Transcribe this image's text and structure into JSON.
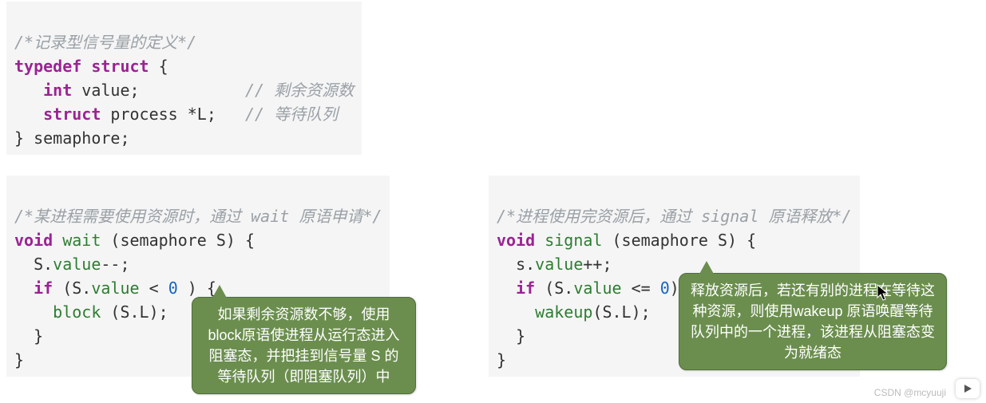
{
  "top": {
    "comment": "/*记录型信号量的定义*/",
    "l1_kw1": "typedef",
    "l1_kw2": "struct",
    "l1_brace": " {",
    "l2_indent": "   ",
    "l2_type": "int",
    "l2_name": " value;",
    "l2_pad": "           ",
    "l2_comment": "// 剩余资源数",
    "l3_indent": "   ",
    "l3_kw": "struct",
    "l3_rest": " process *L;",
    "l3_pad": "   ",
    "l3_comment": "// 等待队列",
    "l4": "} semaphore;"
  },
  "wait": {
    "comment": "/*某进程需要使用资源时，通过 wait 原语申请*/",
    "l1_void": "void",
    "l1_fn": " wait ",
    "l1_sig": "(semaphore S) {",
    "l2_pre": "  S.",
    "l2_mem": "value",
    "l2_post": "--;",
    "l3_pre": "  ",
    "l3_if": "if",
    "l3_mid1": " (S.",
    "l3_mem": "value",
    "l3_mid2": " < ",
    "l3_zero": "0",
    "l3_end": " ) {",
    "l4_pre": "    ",
    "l4_fn": "block",
    "l4_post": " (S.L);",
    "l5": "  }",
    "l6": "}"
  },
  "signal": {
    "comment": "/*进程使用完资源后，通过 signal 原语释放*/",
    "l1_void": "void",
    "l1_fn": " signal ",
    "l1_sig": "(semaphore S) {",
    "l2_pre": "  s.",
    "l2_mem": "value",
    "l2_post": "++;",
    "l3_pre": "  ",
    "l3_if": "if",
    "l3_mid1": " (S.",
    "l3_mem": "value",
    "l3_mid2": " <= ",
    "l3_zero": "0",
    "l3_end": ") {",
    "l4_pre": "    ",
    "l4_fn": "wakeup",
    "l4_post": "(S.L);",
    "l5": "  }",
    "l6": "}"
  },
  "bubbles": {
    "left": "如果剩余资源数不够，使用block原语使进程从运行态进入阻塞态，并把挂到信号量 S 的等待队列（即阻塞队列）中",
    "right": "释放资源后，若还有别的进程在等待这种资源，则使用wakeup 原语唤醒等待队列中的一个进程，该进程从阻塞态变为就绪态"
  },
  "watermark": "CSDN @mcyuuji"
}
